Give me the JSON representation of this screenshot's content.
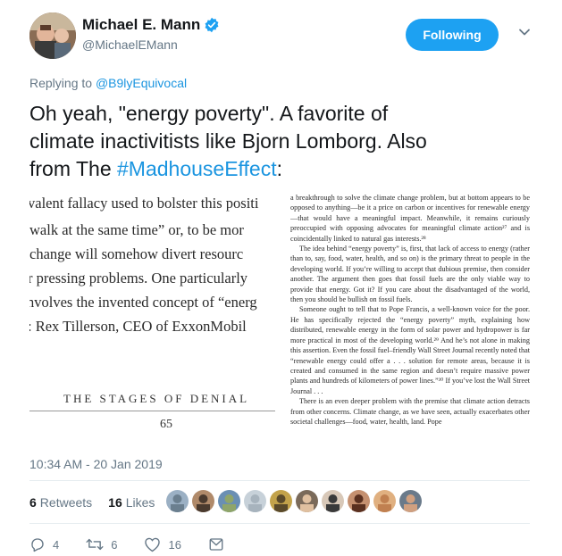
{
  "author": {
    "display_name": "Michael E. Mann",
    "handle": "@MichaelEMann",
    "verified": true
  },
  "follow_button": {
    "label": "Following"
  },
  "reply": {
    "prefix": "Replying to",
    "target": "@B9lyEquivocal"
  },
  "tweet": {
    "text_line1": "Oh yeah, \"energy poverty\". A favorite of",
    "text_line2": "climate inactivitists like Bjorn Lomborg. Also",
    "text_line3_prefix": "from The ",
    "hashtag": "#MadhouseEffect",
    "text_line3_suffix": ":"
  },
  "media": {
    "left_page_lines": [
      "valent fallacy used to bolster this positi",
      "walk at the same time” or, to be mor",
      "change will somehow divert resourc",
      "r pressing problems. One particularly",
      "nvolves the invented concept of “energ",
      ": Rex Tillerson, CEO of ExxonMobil"
    ],
    "chapter_title": "THE STAGES OF DENIAL",
    "page_number": "65",
    "right_page_paragraphs": [
      "a breakthrough to solve the climate change problem, but at bottom appears to be opposed to anything—be it a price on carbon or incentives for renewable energy—that would have a meaningful impact. Meanwhile, it remains curiously preoccupied with opposing advocates for meaningful climate action²⁷ and is coincidentally linked to natural gas interests.²⁸",
      "The idea behind “energy poverty” is, first, that lack of access to energy (rather than to, say, food, water, health, and so on) is the primary threat to people in the developing world. If you’re willing to accept that dubious premise, then consider another. The argument then goes that fossil fuels are the only viable way to provide that energy. Got it? If you care about the disadvantaged of the world, then you should be bullish on fossil fuels.",
      "Someone ought to tell that to Pope Francis, a well-known voice for the poor. He has specifically rejected the “energy poverty” myth, explaining how distributed, renewable energy in the form of solar power and hydropower is far more practical in most of the developing world.²⁹ And he’s not alone in making this assertion. Even the fossil fuel–friendly Wall Street Journal recently noted that “renewable energy could offer a . . . solution for remote areas, because it is created and consumed in the same region and doesn’t require massive power plants and hundreds of kilometers of power lines.”³⁰ If you’ve lost the Wall Street Journal . . .",
      "There is an even deeper problem with the premise that climate action detracts from other concerns. Climate change, as we have seen, actually exacerbates other societal challenges—food, water, health, land. Pope"
    ]
  },
  "timestamp": "10:34 AM - 20 Jan 2019",
  "stats": {
    "retweets_count": "6",
    "retweets_label": "Retweets",
    "likes_count": "16",
    "likes_label": "Likes"
  },
  "likers_count": 10,
  "actions": {
    "reply_count": "4",
    "retweet_count": "6",
    "like_count": "16"
  },
  "colors": {
    "accent": "#1da1f2",
    "link": "#1b95e0",
    "muted": "#657786",
    "text": "#14171a"
  },
  "icons": [
    "verified-badge-icon",
    "chevron-down-icon",
    "reply-icon",
    "retweet-icon",
    "heart-icon",
    "message-icon"
  ]
}
